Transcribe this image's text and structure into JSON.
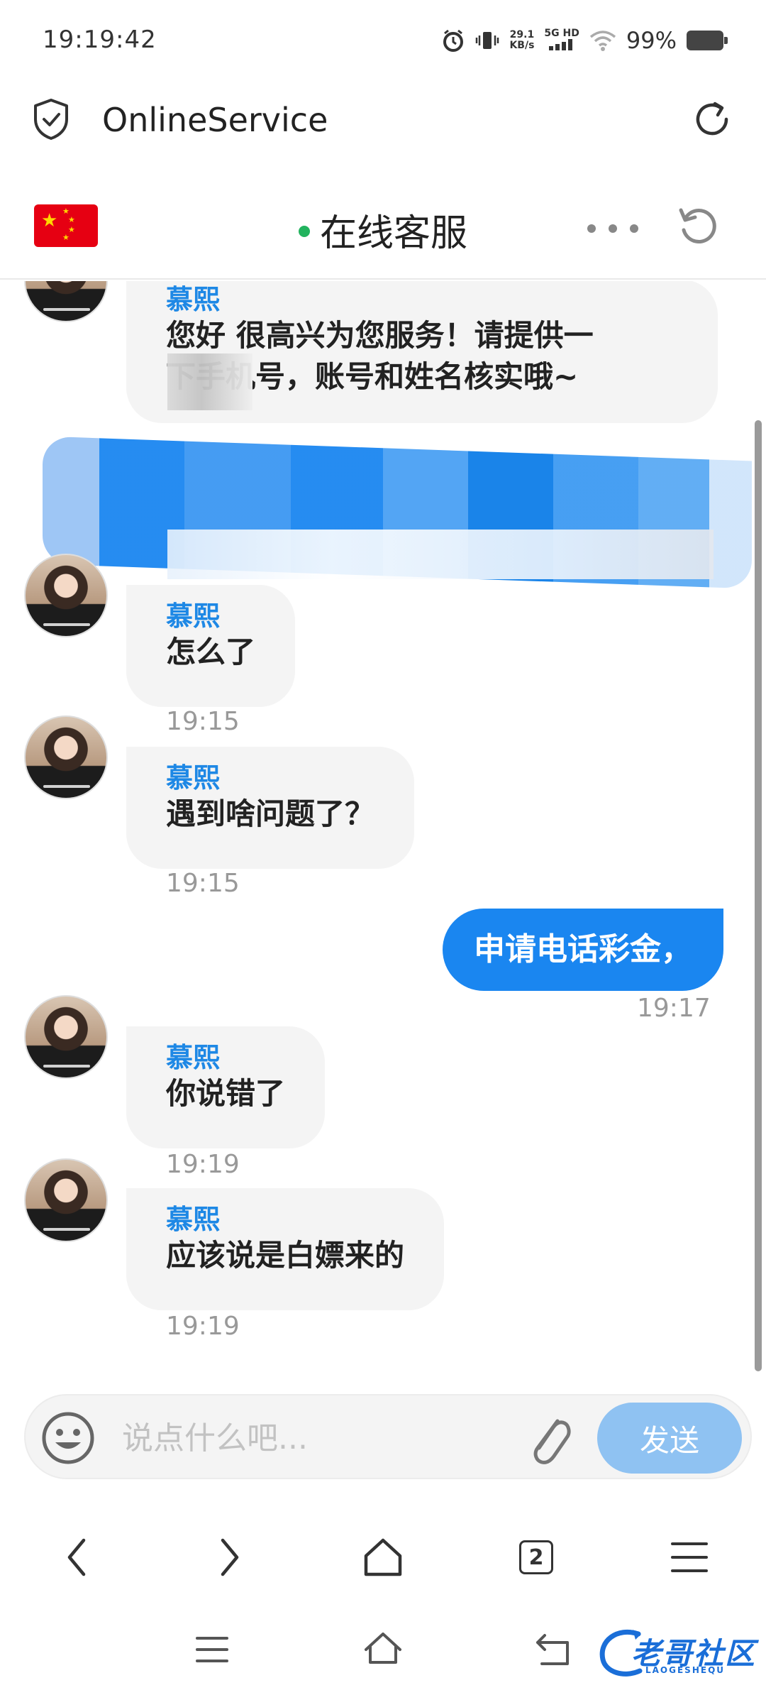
{
  "status_bar": {
    "time": "19:19:42",
    "net_speed_value": "29.1",
    "net_speed_unit": "KB/s",
    "network": "5G HD",
    "battery": "99%"
  },
  "browser": {
    "title": "OnlineService"
  },
  "chat_header": {
    "title": "在线客服",
    "status_color": "#22b35e"
  },
  "messages": [
    {
      "direction": "in",
      "sender": "慕熙",
      "text_line1": "您好 很高兴为您服务！请提供一",
      "text_line2": "下手机号，账号和姓名核实哦~"
    },
    {
      "direction": "in",
      "sender": "慕熙",
      "text": "怎么了",
      "time": "19:15"
    },
    {
      "direction": "in",
      "sender": "慕熙",
      "text": "遇到啥问题了？",
      "time": "19:15"
    },
    {
      "direction": "out",
      "text": "申请电话彩金，",
      "time": "19:17"
    },
    {
      "direction": "in",
      "sender": "慕熙",
      "text": "你说错了",
      "time": "19:19"
    },
    {
      "direction": "in",
      "sender": "慕熙",
      "text": "应该说是白嫖来的",
      "time": "19:19"
    }
  ],
  "input": {
    "placeholder": "说点什么吧...",
    "send_label": "发送"
  },
  "nav": {
    "tab_count": "2"
  },
  "watermark": {
    "text": "老哥社区",
    "sub": "LAOGESHEQU"
  },
  "colors": {
    "accent": "#1a86f0",
    "sender_name": "#1e88e5",
    "send_button": "#8fc2f2",
    "bubble_in": "#f4f4f4"
  }
}
